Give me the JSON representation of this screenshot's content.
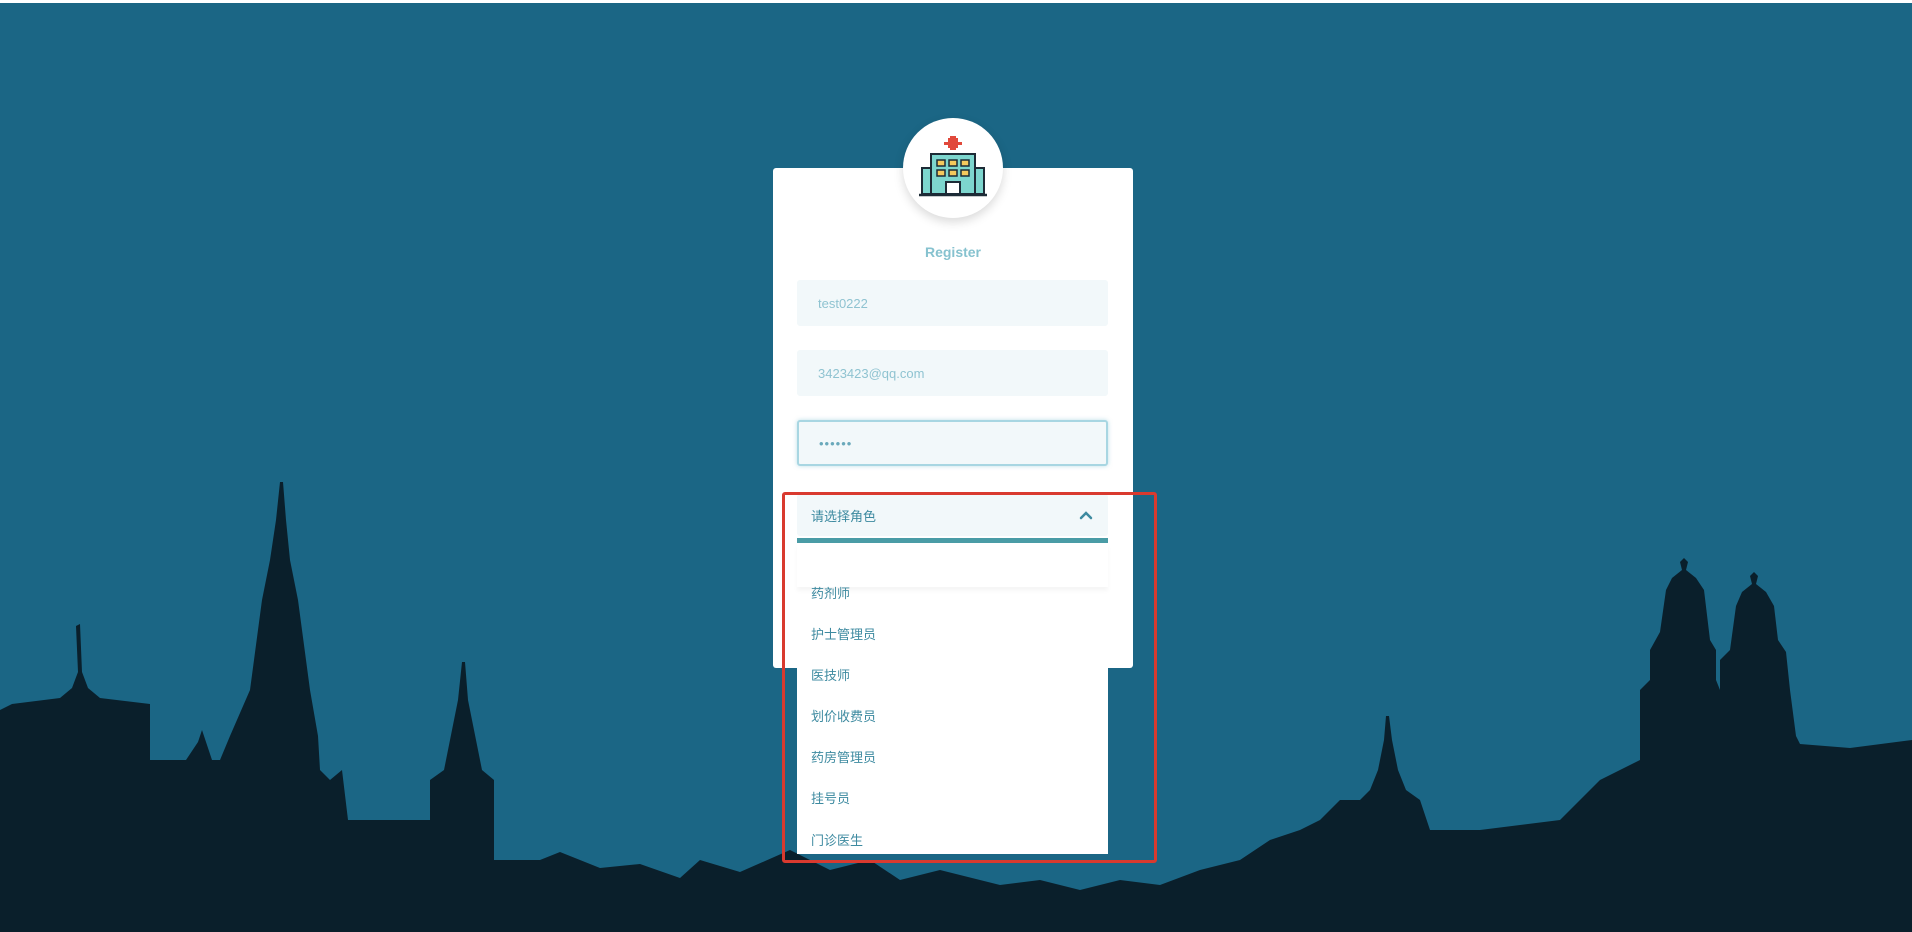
{
  "form": {
    "title": "Register",
    "username_value": "test0222",
    "email_value": "3423423@qq.com",
    "password_value": "••••••"
  },
  "role_select": {
    "placeholder": "请选择角色",
    "options": [
      "药剂师",
      "护士管理员",
      "医技师",
      "划价收费员",
      "药房管理员",
      "挂号员",
      "门诊医生"
    ]
  },
  "colors": {
    "background": "#1b6685",
    "skyline": "#0a1f2b",
    "accent": "#4a9ca6",
    "highlight": "#d93a2f"
  },
  "icons": {
    "logo": "hospital-icon",
    "select_toggle": "chevron-up-icon"
  }
}
